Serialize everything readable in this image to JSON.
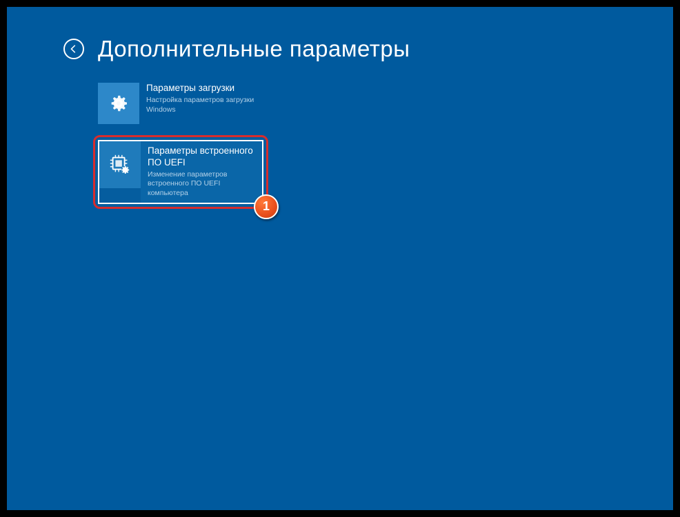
{
  "header": {
    "title": "Дополнительные параметры"
  },
  "tiles": [
    {
      "title": "Параметры загрузки",
      "desc": "Настройка параметров загрузки Windows"
    },
    {
      "title": "Параметры встроенного ПО UEFI",
      "desc": "Изменение параметров встроенного ПО UEFI компьютера"
    }
  ],
  "annotation": {
    "badge": "1"
  }
}
